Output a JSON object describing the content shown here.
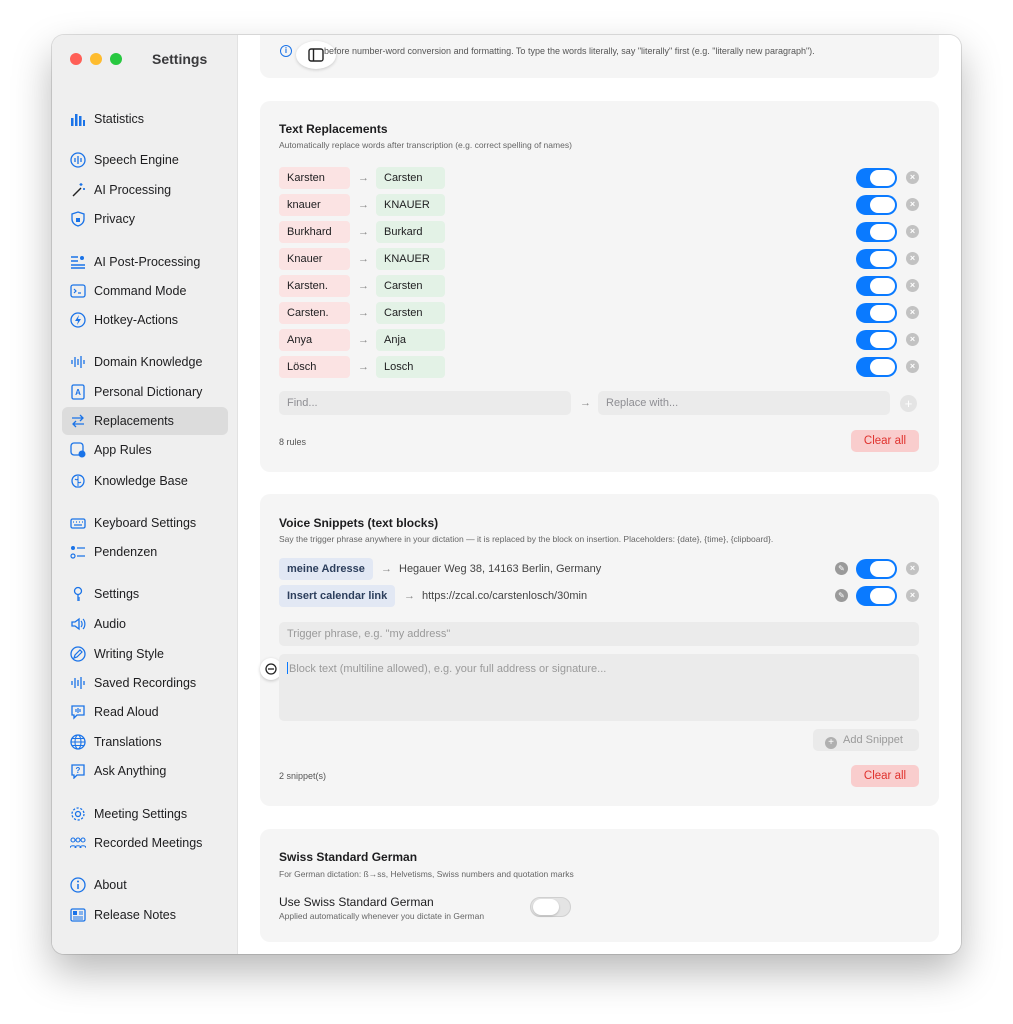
{
  "window": {
    "title": "Settings"
  },
  "sidebar": {
    "items": [
      {
        "label": "Statistics",
        "icon": "bar-chart-icon",
        "active": false
      },
      {
        "label": "Speech Engine",
        "icon": "waveform-circle-icon",
        "active": false
      },
      {
        "label": "AI Processing",
        "icon": "magic-wand-icon",
        "active": false
      },
      {
        "label": "Privacy",
        "icon": "lock-shield-icon",
        "active": false
      },
      {
        "label": "AI Post-Processing",
        "icon": "list-edit-icon",
        "active": false
      },
      {
        "label": "Command Mode",
        "icon": "terminal-icon",
        "active": false
      },
      {
        "label": "Hotkey-Actions",
        "icon": "bolt-circle-icon",
        "active": false
      },
      {
        "label": "Domain Knowledge",
        "icon": "waveform-icon",
        "active": false
      },
      {
        "label": "Personal Dictionary",
        "icon": "dictionary-icon",
        "active": false
      },
      {
        "label": "Replacements",
        "icon": "swap-arrows-icon",
        "active": true
      },
      {
        "label": "App Rules",
        "icon": "app-badge-icon",
        "active": false
      },
      {
        "label": "Knowledge Base",
        "icon": "brain-icon",
        "active": false
      },
      {
        "label": "Keyboard Settings",
        "icon": "keyboard-icon",
        "active": false
      },
      {
        "label": "Pendenzen",
        "icon": "checklist-icon",
        "active": false
      },
      {
        "label": "Settings",
        "icon": "key-icon",
        "active": false
      },
      {
        "label": "Audio",
        "icon": "speaker-icon",
        "active": false
      },
      {
        "label": "Writing Style",
        "icon": "pencil-circle-icon",
        "active": false
      },
      {
        "label": "Saved Recordings",
        "icon": "waveform-icon",
        "active": false
      },
      {
        "label": "Read Aloud",
        "icon": "speech-bubble-icon",
        "active": false
      },
      {
        "label": "Translations",
        "icon": "globe-icon",
        "active": false
      },
      {
        "label": "Ask Anything",
        "icon": "question-bubble-icon",
        "active": false
      },
      {
        "label": "Meeting Settings",
        "icon": "gear-icon",
        "active": false
      },
      {
        "label": "Recorded Meetings",
        "icon": "people-icon",
        "active": false
      },
      {
        "label": "About",
        "icon": "info-icon",
        "active": false
      },
      {
        "label": "Release Notes",
        "icon": "newspaper-icon",
        "active": false
      }
    ]
  },
  "top_info": {
    "text": "before number-word conversion and formatting. To type the words literally, say \"literally\" first (e.g. \"literally new paragraph\")."
  },
  "text_replacements": {
    "title": "Text Replacements",
    "subtitle": "Automatically replace words after transcription (e.g. correct spelling of names)",
    "rules": [
      {
        "find": "Karsten",
        "replace": "Carsten",
        "enabled": true
      },
      {
        "find": "knauer",
        "replace": "KNAUER",
        "enabled": true
      },
      {
        "find": "Burkhard",
        "replace": "Burkard",
        "enabled": true
      },
      {
        "find": "Knauer",
        "replace": "KNAUER",
        "enabled": true
      },
      {
        "find": "Karsten.",
        "replace": "Carsten",
        "enabled": true
      },
      {
        "find": "Carsten.",
        "replace": "Carsten",
        "enabled": true
      },
      {
        "find": "Anya",
        "replace": "Anja",
        "enabled": true
      },
      {
        "find": "Lösch",
        "replace": "Losch",
        "enabled": true
      }
    ],
    "arrow": "→",
    "find_placeholder": "Find...",
    "replace_placeholder": "Replace with...",
    "count": "8 rules",
    "clear_all": "Clear all"
  },
  "voice_snippets": {
    "title": "Voice Snippets (text blocks)",
    "subtitle": "Say the trigger phrase anywhere in your dictation — it is replaced by the block on insertion. Placeholders: {date}, {time}, {clipboard}.",
    "snippets": [
      {
        "trigger": "meine Adresse",
        "text": "Hegauer Weg 38, 14163 Berlin, Germany",
        "enabled": true
      },
      {
        "trigger": "Insert calendar link",
        "text": "https://zcal.co/carstenlosch/30min",
        "enabled": true
      }
    ],
    "arrow": "→",
    "trigger_placeholder": "Trigger phrase, e.g. \"my address\"",
    "block_placeholder": "Block text (multiline allowed), e.g. your full address or signature...",
    "add_button": "Add Snippet",
    "count": "2 snippet(s)",
    "clear_all": "Clear all"
  },
  "swiss_german": {
    "title": "Swiss Standard German",
    "subtitle": "For German dictation: ß→ss, Helvetisms, Swiss numbers and quotation marks",
    "option_label": "Use Swiss Standard German",
    "option_sub": "Applied automatically whenever you dictate in German",
    "enabled": false
  },
  "colors": {
    "accent": "#0a7aff",
    "danger": "#e0322e",
    "find_chip": "#fbe3e3",
    "replace_chip": "#e3f2e6"
  }
}
